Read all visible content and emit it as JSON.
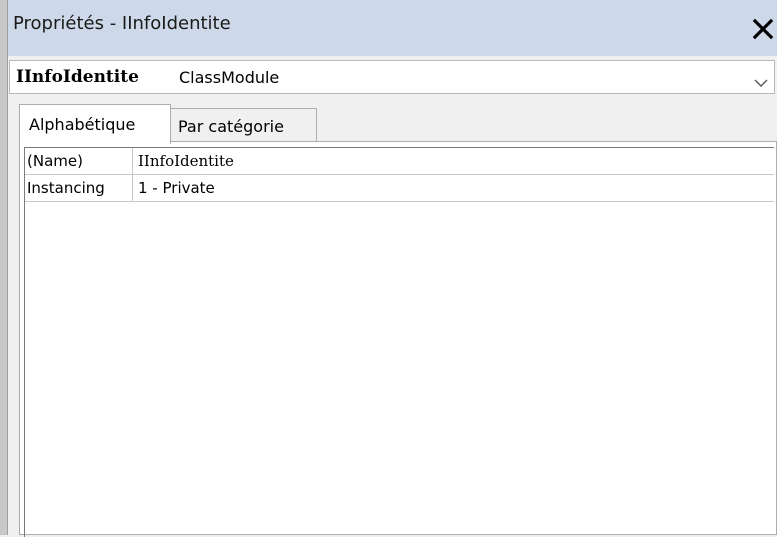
{
  "window": {
    "title": "Propriétés - IInfoIdentite",
    "close_icon": "close-icon"
  },
  "object_selector": {
    "name": "IInfoIdentite",
    "type": "ClassModule",
    "dropdown_icon": "chevron-down-icon"
  },
  "tabs": [
    {
      "label": "Alphabétique",
      "selected": true
    },
    {
      "label": "Par catégorie",
      "selected": false
    }
  ],
  "properties": [
    {
      "name": "(Name)",
      "value": "IInfoIdentite"
    },
    {
      "name": "Instancing",
      "value": "1 - Private"
    }
  ]
}
